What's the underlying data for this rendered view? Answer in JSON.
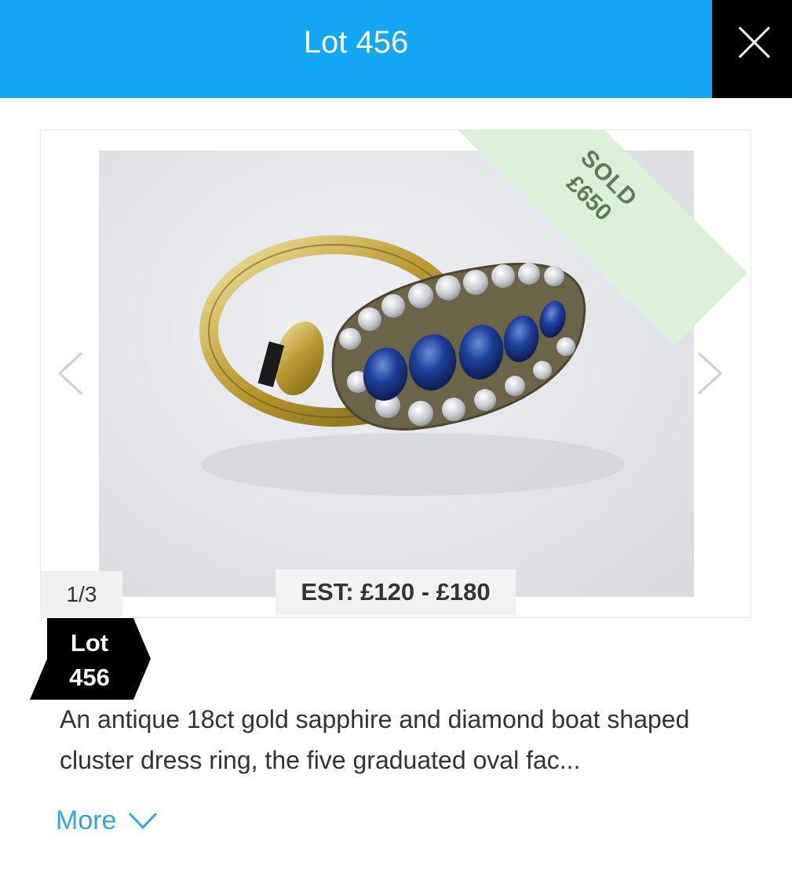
{
  "header": {
    "title": "Lot 456",
    "close_icon": "close-icon",
    "background_color": "#12a6f5"
  },
  "gallery": {
    "image_alt": "Antique sapphire and diamond ring",
    "counter": "1/3",
    "estimate": "EST: £120 - £180",
    "sold_label": "SOLD",
    "sold_price": "£650",
    "prev_icon": "chevron-left-icon",
    "next_icon": "chevron-right-icon"
  },
  "lot_badge": {
    "line1": "Lot",
    "line2": "456"
  },
  "description": {
    "text": "An antique 18ct gold sapphire and diamond boat shaped cluster dress ring, the five graduated oval fac..."
  },
  "more": {
    "label": "More",
    "icon": "chevron-down-icon",
    "color": "#2ea6de"
  }
}
